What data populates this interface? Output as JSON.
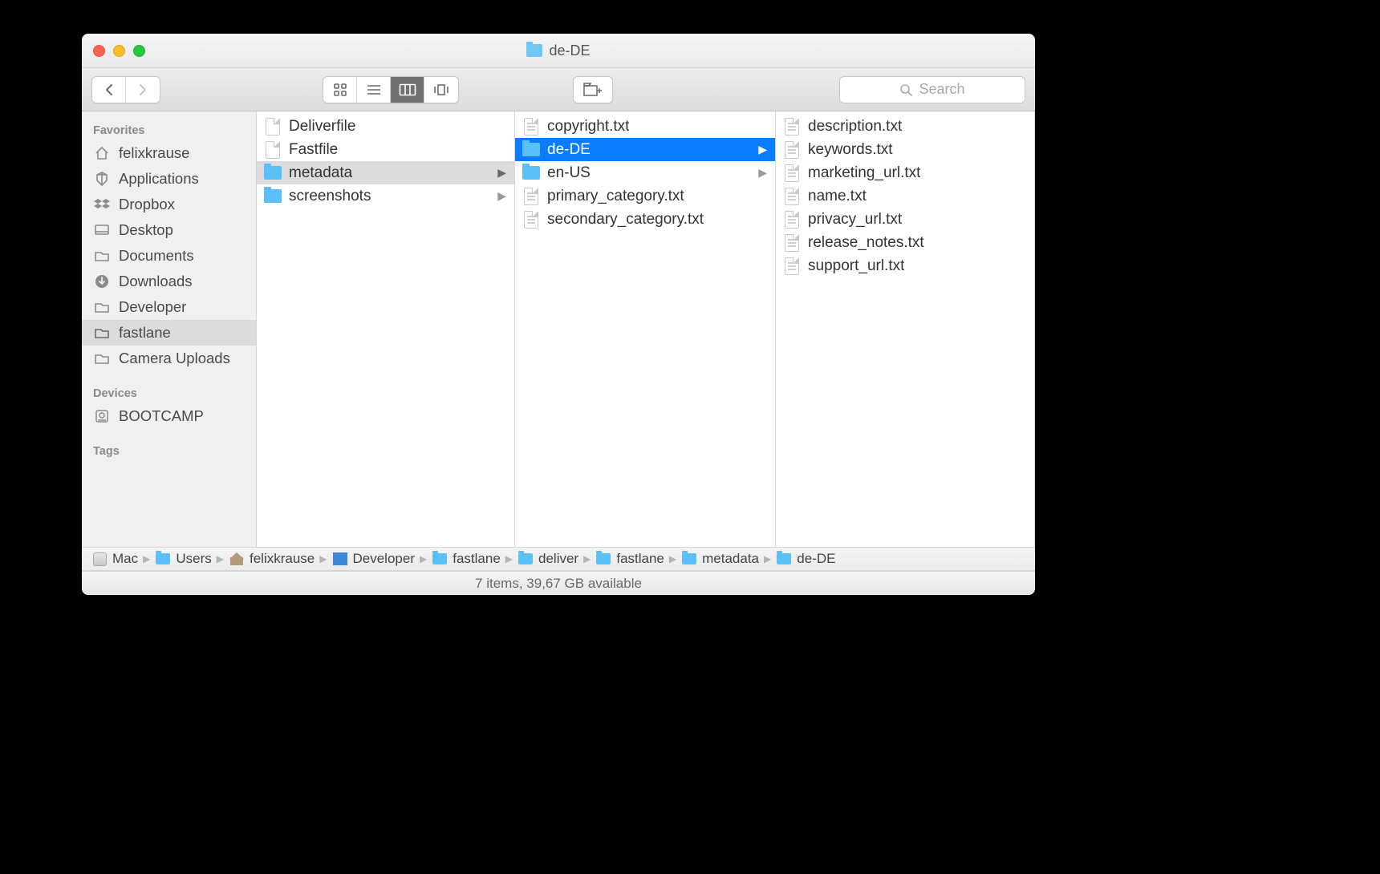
{
  "window": {
    "title": "de-DE"
  },
  "toolbar": {
    "search_placeholder": "Search"
  },
  "sidebar": {
    "sections": [
      {
        "title": "Favorites",
        "items": [
          {
            "label": "felixkrause",
            "icon": "home"
          },
          {
            "label": "Applications",
            "icon": "apps"
          },
          {
            "label": "Dropbox",
            "icon": "dropbox"
          },
          {
            "label": "Desktop",
            "icon": "desktop"
          },
          {
            "label": "Documents",
            "icon": "documents"
          },
          {
            "label": "Downloads",
            "icon": "downloads"
          },
          {
            "label": "Developer",
            "icon": "folder"
          },
          {
            "label": "fastlane",
            "icon": "folder",
            "selected": true
          },
          {
            "label": "Camera Uploads",
            "icon": "folder"
          }
        ]
      },
      {
        "title": "Devices",
        "items": [
          {
            "label": "BOOTCAMP",
            "icon": "disk"
          }
        ]
      },
      {
        "title": "Tags",
        "items": []
      }
    ]
  },
  "columns": [
    [
      {
        "name": "Deliverfile",
        "type": "file"
      },
      {
        "name": "Fastfile",
        "type": "file"
      },
      {
        "name": "metadata",
        "type": "folder",
        "chevron": true,
        "selected": "grey"
      },
      {
        "name": "screenshots",
        "type": "folder",
        "chevron": true
      }
    ],
    [
      {
        "name": "copyright.txt",
        "type": "textfile"
      },
      {
        "name": "de-DE",
        "type": "folder",
        "chevron": true,
        "selected": "blue"
      },
      {
        "name": "en-US",
        "type": "folder",
        "chevron": true
      },
      {
        "name": "primary_category.txt",
        "type": "textfile"
      },
      {
        "name": "secondary_category.txt",
        "type": "textfile"
      }
    ],
    [
      {
        "name": "description.txt",
        "type": "textfile"
      },
      {
        "name": "keywords.txt",
        "type": "textfile"
      },
      {
        "name": "marketing_url.txt",
        "type": "textfile"
      },
      {
        "name": "name.txt",
        "type": "textfile"
      },
      {
        "name": "privacy_url.txt",
        "type": "textfile"
      },
      {
        "name": "release_notes.txt",
        "type": "textfile"
      },
      {
        "name": "support_url.txt",
        "type": "textfile"
      }
    ]
  ],
  "pathbar": [
    {
      "label": "Mac",
      "icon": "disk"
    },
    {
      "label": "Users",
      "icon": "folder"
    },
    {
      "label": "felixkrause",
      "icon": "home"
    },
    {
      "label": "Developer",
      "icon": "dev"
    },
    {
      "label": "fastlane",
      "icon": "folder"
    },
    {
      "label": "deliver",
      "icon": "folder"
    },
    {
      "label": "fastlane",
      "icon": "folder"
    },
    {
      "label": "metadata",
      "icon": "folder"
    },
    {
      "label": "de-DE",
      "icon": "folder"
    }
  ],
  "statusbar": {
    "text": "7 items, 39,67 GB available"
  }
}
